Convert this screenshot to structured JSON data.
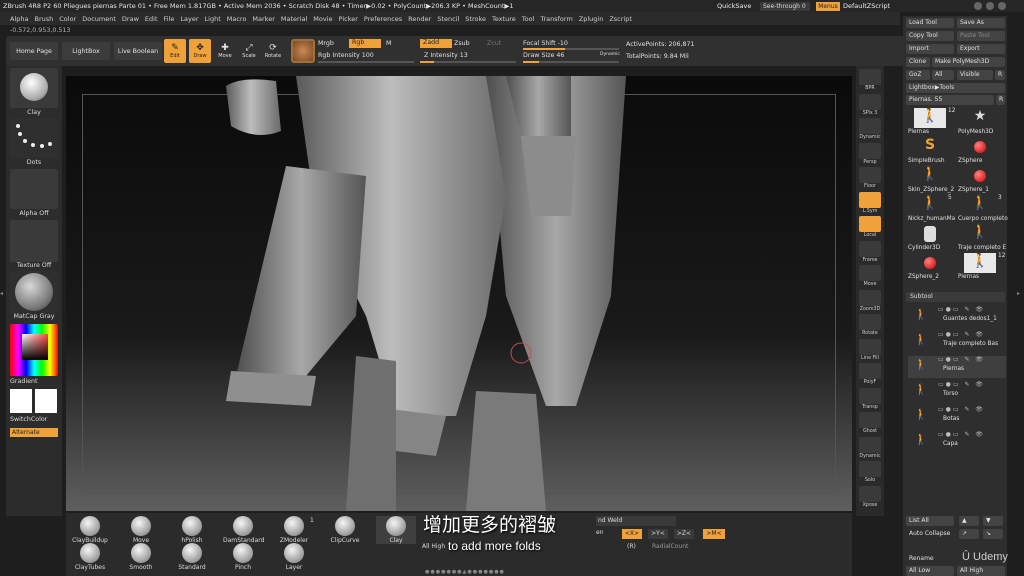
{
  "titlebar": {
    "text": "ZBrush 4R8 P2    60 Pliegues piernas Parte 01    • Free Mem 1.817GB • Active Mem 2036 • Scratch Disk 48 • Timer▶0.02 • PolyCount▶206.3 KP • MeshCount▶1",
    "quicksave": "QuickSave",
    "seethrough": "See-through  0",
    "menus": "Menus",
    "script": "DefaultZScript"
  },
  "menubar": [
    "Alpha",
    "Brush",
    "Color",
    "Document",
    "Draw",
    "Edit",
    "File",
    "Layer",
    "Light",
    "Macro",
    "Marker",
    "Material",
    "Movie",
    "Picker",
    "Preferences",
    "Render",
    "Stencil",
    "Stroke",
    "Texture",
    "Tool",
    "Transform",
    "Zplugin",
    "Zscript"
  ],
  "coords": "-0.572,0.953,0.513",
  "toolbar": {
    "home": "Home Page",
    "lightbox": "LightBox",
    "liveboolean": "Live Boolean",
    "edit": "Edit",
    "draw": "Draw",
    "move": "Move",
    "scale": "Scale",
    "rotate": "Rotate",
    "mrgb": "Mrgb",
    "rgb": "Rgb",
    "m": "M",
    "rgb_intensity": "Rgb Intensity 100",
    "zadd": "Zadd",
    "zsub": "Zsub",
    "zcut": "Zcut",
    "z_intensity": "Z Intensity 13",
    "focal_shift": "Focal Shift -10",
    "draw_size": "Draw Size 46",
    "dynamic": "Dynamic",
    "active_points": "ActivePoints: 206,871",
    "total_points": "TotalPoints: 9.84 Mil"
  },
  "leftshelf": {
    "brush": "Clay",
    "stroke": "Dots",
    "alpha": "Alpha Off",
    "texture": "Texture Off",
    "material": "MatCap Gray",
    "gradient": "Gradient",
    "switchcolor": "SwitchColor",
    "alternate": "Alternate"
  },
  "rightshelf": [
    "BPR",
    "SPix 3",
    "Dynamic",
    "Persp",
    "Floor",
    "L.Sym",
    "Local",
    "Frame",
    "Move",
    "Zoom3D",
    "Rotate",
    "Line Fill",
    "PolyF",
    "Transp",
    "Ghost",
    "Dynamic",
    "Solo",
    "Xpose"
  ],
  "tray": {
    "load_tool": "Load Tool",
    "save_as": "Save As",
    "copy_tool": "Copy Tool",
    "paste_tool": "Paste Tool",
    "import": "Import",
    "export": "Export",
    "clone": "Clone",
    "make_polymesh": "Make PolyMesh3D",
    "goz": "GoZ",
    "all": "All",
    "visible": "Visible",
    "r": "R",
    "lightbox_tools": "Lightbox▶Tools",
    "piernas_slider": "Piernas. 55",
    "tools": [
      {
        "label": "Piernas",
        "count": "12"
      },
      {
        "label": "PolyMesh3D",
        "count": ""
      },
      {
        "label": "SimpleBrush",
        "count": ""
      },
      {
        "label": "ZSphere",
        "count": ""
      },
      {
        "label": "Skin_ZSphere_2",
        "count": ""
      },
      {
        "label": "ZSphere_1",
        "count": ""
      },
      {
        "label": "Nickz_humanMa",
        "count": "5"
      },
      {
        "label": "Cuerpo completo",
        "count": "3"
      },
      {
        "label": "Cylinder3D",
        "count": ""
      },
      {
        "label": "Traje completo E",
        "count": ""
      },
      {
        "label": "ZSphere_2",
        "count": ""
      },
      {
        "label": "Piernas",
        "count": "12"
      }
    ],
    "subtool_header": "Subtool",
    "subtools": [
      "Guantes dedos1_1",
      "Traje completo Bas",
      "Piernas",
      "Torso",
      "Botas",
      "Capa"
    ],
    "list_all": "List All",
    "auto_collapse": "Auto Collapse",
    "rename": "Rename",
    "all_low": "All Low",
    "all_high": "All High"
  },
  "bottombar": {
    "brushes_row1": [
      "ClayBuildup",
      "Move",
      "hPolish",
      "DamStandard",
      "ZModeler",
      "ClipCurve",
      "Clay"
    ],
    "brushes_row2": [
      "ClayTubes",
      "Smooth",
      "Standard",
      "Pinch",
      "Layer"
    ],
    "zmodeler_count": "1",
    "weld": "nd Weld",
    "gen": "en",
    "x_btn": "<X>",
    "y_btn": ">Y<",
    "z_btn": ">Z<",
    "m_btn": ">M<",
    "r_btn": "(R)",
    "radial_count": "RadialCount",
    "all_high": "All High"
  },
  "subtitles": {
    "cn": "增加更多的褶皱",
    "en": "to add more folds"
  },
  "watermark": "Udemy",
  "colors": {
    "accent": "#f0a23a",
    "panel": "#2e2e2e"
  }
}
